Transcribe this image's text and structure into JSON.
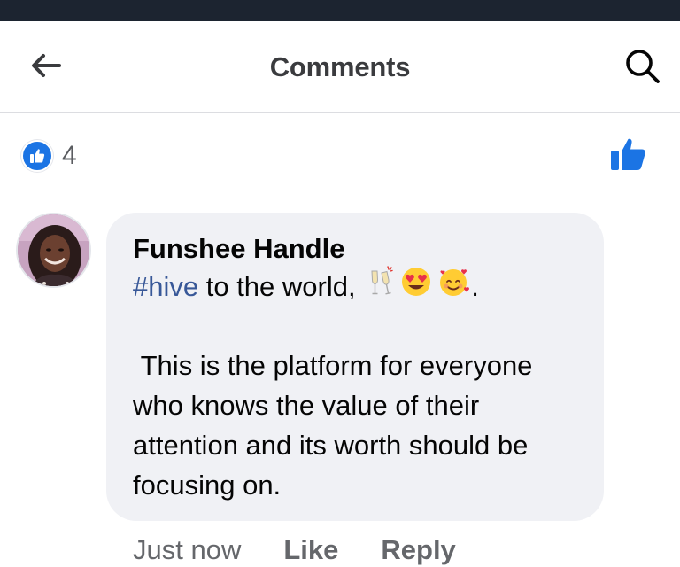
{
  "header": {
    "title": "Comments",
    "back_icon": "arrow-left-icon",
    "search_icon": "search-icon"
  },
  "reactions": {
    "count": "4",
    "icon": "like-icon"
  },
  "comment": {
    "author": "Funshee Handle",
    "hashtag": "#hive",
    "line1_text": " to the world, ",
    "line1_end": ".",
    "emojis": [
      "clinking-glasses-icon",
      "heart-eyes-icon",
      "smiling-face-with-hearts-icon"
    ],
    "body": " This is the platform for everyone who knows the value of their attention and its worth should be focusing on.",
    "time": "Just now",
    "like_label": "Like",
    "reply_label": "Reply"
  },
  "colors": {
    "status_bar": "#1c2430",
    "accent": "#1b74e4",
    "hashtag": "#385898",
    "bubble": "#f0f1f5",
    "meta_text": "#65676b"
  }
}
